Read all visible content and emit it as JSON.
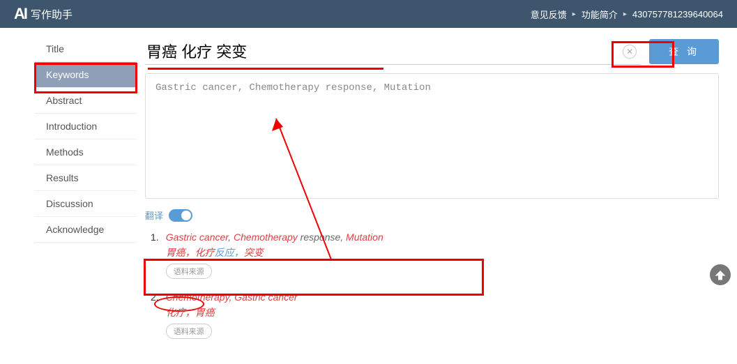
{
  "header": {
    "logo": "AI",
    "logo_text": "写作助手",
    "links": [
      "意见反馈",
      "功能简介",
      "430757781239640064"
    ]
  },
  "sidebar": {
    "items": [
      {
        "label": "Title"
      },
      {
        "label": "Keywords"
      },
      {
        "label": "Abstract"
      },
      {
        "label": "Introduction"
      },
      {
        "label": "Methods"
      },
      {
        "label": "Results"
      },
      {
        "label": "Discussion"
      },
      {
        "label": "Acknowledge"
      }
    ],
    "active_index": 1
  },
  "search": {
    "value": "胃癌 化疗 突变",
    "query_btn": "查 询"
  },
  "result_box": {
    "text": "Gastric cancer, Chemotherapy response, Mutation"
  },
  "translate": {
    "label": "翻译",
    "on": true
  },
  "results": [
    {
      "num": "1.",
      "en_parts": [
        {
          "t": "Gastric cancer",
          "hl": true
        },
        {
          "t": ", ",
          "hl": false
        },
        {
          "t": "Chemotherapy",
          "hl": true
        },
        {
          "t": " response, ",
          "hl": false
        },
        {
          "t": "Mutation",
          "hl": true
        }
      ],
      "zh_parts": [
        {
          "t": "胃癌，化疗",
          "hl": true
        },
        {
          "t": "反应，",
          "hl": false
        },
        {
          "t": "突变",
          "hl": true
        }
      ],
      "source": "语料来源"
    },
    {
      "num": "2.",
      "en_parts": [
        {
          "t": "Chemotherapy",
          "hl": true
        },
        {
          "t": ", ",
          "hl": false
        },
        {
          "t": "Gastric cancer",
          "hl": true
        }
      ],
      "zh_parts": [
        {
          "t": "化疗，胃癌",
          "hl": true
        }
      ],
      "source": "语料来源"
    }
  ]
}
